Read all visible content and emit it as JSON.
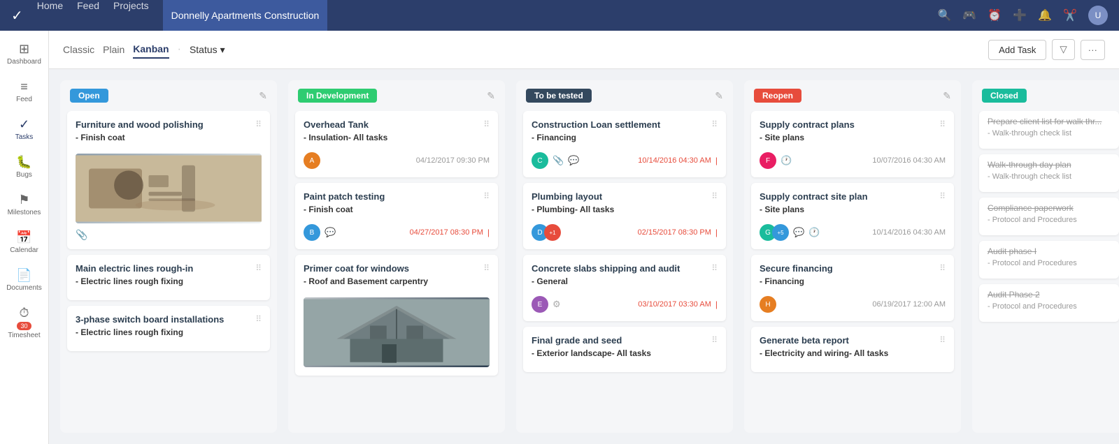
{
  "nav": {
    "logo": "✓",
    "links": [
      "Home",
      "Feed",
      "Projects",
      "Donnelly Apartments Construction"
    ],
    "active_link": "Donnelly Apartments Construction",
    "icons": [
      "🔍",
      "🎮",
      "🕐",
      "➕",
      "🔔",
      "✂️"
    ],
    "avatar_initials": "U"
  },
  "sidebar": {
    "items": [
      {
        "icon": "⊞",
        "label": "Dashboard"
      },
      {
        "icon": "≡",
        "label": "Feed"
      },
      {
        "icon": "✓",
        "label": "Tasks"
      },
      {
        "icon": "🐛",
        "label": "Bugs"
      },
      {
        "icon": "⚑",
        "label": "Milestones"
      },
      {
        "icon": "📅",
        "label": "Calendar"
      },
      {
        "icon": "📄",
        "label": "Documents"
      },
      {
        "icon": "⏱",
        "label": "Timesheet",
        "badge": "30"
      }
    ]
  },
  "toolbar": {
    "views": [
      "Classic",
      "Plain",
      "Kanban"
    ],
    "active_view": "Kanban",
    "filter_label": "Status",
    "add_task_label": "Add Task"
  },
  "columns": [
    {
      "id": "open",
      "badge_label": "Open",
      "badge_class": "badge-open",
      "cards": [
        {
          "title": "Furniture and wood polishing",
          "subtitle": "- Finish coat",
          "has_image": true,
          "image_type": "desk",
          "footer_avatars": [],
          "has_attach": true,
          "date": "",
          "date_overdue": false
        },
        {
          "title": "Main electric lines rough-in",
          "subtitle": "- Electric lines rough fixing",
          "has_image": false,
          "footer_avatars": [],
          "date": "",
          "date_overdue": false
        },
        {
          "title": "3-phase switch board installations",
          "subtitle": "- Electric lines rough fixing",
          "has_image": false,
          "footer_avatars": [],
          "date": "",
          "date_overdue": false
        }
      ]
    },
    {
      "id": "indev",
      "badge_label": "In Development",
      "badge_class": "badge-indev",
      "cards": [
        {
          "title": "Overhead Tank",
          "subtitle": "- Insulation- All tasks",
          "has_image": false,
          "footer_avatars": [
            {
              "color": "orange",
              "initials": "A"
            }
          ],
          "date": "04/12/2017 09:30 PM",
          "date_overdue": false
        },
        {
          "title": "Paint patch testing",
          "subtitle": "- Finish coat",
          "has_image": false,
          "footer_avatars": [
            {
              "color": "blue",
              "initials": "B"
            }
          ],
          "has_comment": true,
          "date": "04/27/2017 08:30 PM",
          "date_overdue": true
        },
        {
          "title": "Primer coat for windows",
          "subtitle": "- Roof and Basement carpentry",
          "has_image": true,
          "image_type": "roof",
          "footer_avatars": [],
          "date": "",
          "date_overdue": false
        }
      ]
    },
    {
      "id": "tobetested",
      "badge_label": "To be tested",
      "badge_class": "badge-tobetested",
      "cards": [
        {
          "title": "Construction Loan settlement",
          "subtitle": "- Financing",
          "has_image": false,
          "footer_avatars": [
            {
              "color": "teal",
              "initials": "C"
            }
          ],
          "has_attach": true,
          "has_comment": true,
          "date": "10/14/2016 04:30 AM",
          "date_overdue": true
        },
        {
          "title": "Plumbing layout",
          "subtitle": "- Plumbing- All tasks",
          "has_image": false,
          "footer_avatars": [
            {
              "color": "blue",
              "initials": "D"
            },
            {
              "color": "red",
              "initials": "+1"
            }
          ],
          "date": "02/15/2017 08:30 PM",
          "date_overdue": true
        },
        {
          "title": "Concrete slabs shipping and audit",
          "subtitle": "- General",
          "has_image": false,
          "footer_avatars": [
            {
              "color": "purple",
              "initials": "E"
            }
          ],
          "has_settings": true,
          "date": "03/10/2017 03:30 AM",
          "date_overdue": true
        },
        {
          "title": "Final grade and seed",
          "subtitle": "- Exterior landscape- All tasks",
          "has_image": false,
          "footer_avatars": [],
          "date": "",
          "date_overdue": false
        }
      ]
    },
    {
      "id": "reopen",
      "badge_label": "Reopen",
      "badge_class": "badge-reopen",
      "cards": [
        {
          "title": "Supply contract plans",
          "subtitle": "- Site plans",
          "has_image": false,
          "footer_avatars": [
            {
              "color": "pink",
              "initials": "F"
            }
          ],
          "has_clock": true,
          "date": "10/07/2016 04:30 AM",
          "date_overdue": false
        },
        {
          "title": "Supply contract site plan",
          "subtitle": "- Site plans",
          "has_image": false,
          "footer_avatars": [
            {
              "color": "teal",
              "initials": "G"
            },
            {
              "color": "blue",
              "initials": "+5"
            }
          ],
          "has_comment": true,
          "has_clock": true,
          "date": "10/14/2016 04:30 AM",
          "date_overdue": false
        },
        {
          "title": "Secure financing",
          "subtitle": "- Financing",
          "has_image": false,
          "footer_avatars": [
            {
              "color": "orange",
              "initials": "H"
            }
          ],
          "date": "06/19/2017 12:00 AM",
          "date_overdue": false
        },
        {
          "title": "Generate beta report",
          "subtitle": "- Electricity and wiring- All tasks",
          "has_image": false,
          "footer_avatars": [],
          "date": "",
          "date_overdue": false
        }
      ]
    },
    {
      "id": "closed",
      "badge_label": "Closed",
      "badge_class": "badge-closed",
      "cards": [
        {
          "title": "Prepare client list for walk thr...",
          "subtitle": "- Walk-through check list",
          "strikethrough": true
        },
        {
          "title": "Walk-through day plan",
          "subtitle": "- Walk-through check list",
          "strikethrough": true
        },
        {
          "title": "Compliance paperwork",
          "subtitle": "- Protocol and Procedures",
          "strikethrough": true
        },
        {
          "title": "Audit phase I",
          "subtitle": "- Protocol and Procedures",
          "strikethrough": true
        },
        {
          "title": "Audit Phase 2",
          "subtitle": "- Protocol and Procedures",
          "strikethrough": true
        }
      ]
    }
  ]
}
